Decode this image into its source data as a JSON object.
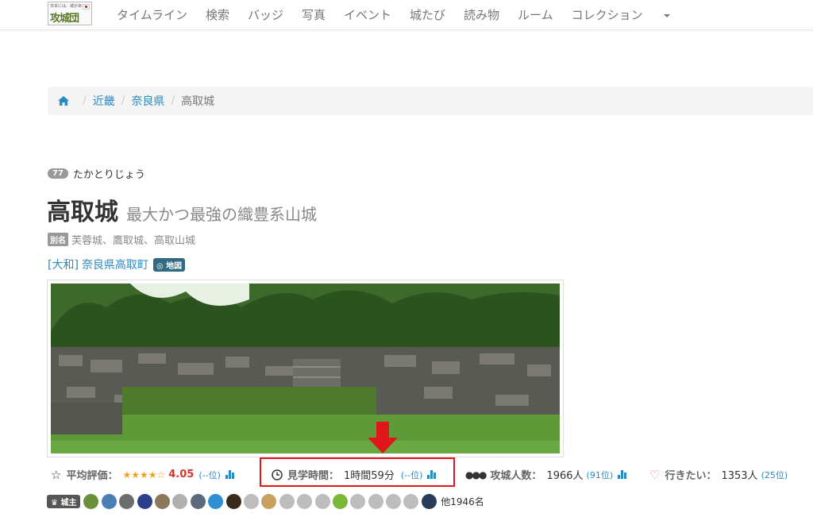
{
  "navbar": {
    "logo": {
      "tagline": "日本には、城がある",
      "mark": "攻城団"
    },
    "items": [
      "タイムライン",
      "検索",
      "バッジ",
      "写真",
      "イベント",
      "城たび",
      "読み物",
      "ルーム"
    ],
    "dropdown": "コレクション"
  },
  "breadcrumb": [
    "近畿",
    "奈良県",
    "高取城"
  ],
  "castle": {
    "number": "77",
    "reading": "たかとりじょう",
    "name": "高取城",
    "subtitle": "最大かつ最強の織豊系山城",
    "alias_tag": "別名",
    "aliases": "芙蓉城、鷹取城、高取山城",
    "province": "[大和]",
    "address": "奈良県高取町",
    "map_label": "地図"
  },
  "stats": {
    "rating": {
      "label": "平均評価：",
      "stars": "★★★★☆",
      "value": "4.05",
      "rank": "(--位)"
    },
    "visit_time": {
      "label": "見学時間：",
      "value": "1時間59分",
      "rank": "(--位)"
    },
    "visitors": {
      "label": "攻城人数：",
      "value": "1966人",
      "rank": "(91位)"
    },
    "want": {
      "label": "行きたい：",
      "value": "1353人",
      "rank": "(25位)"
    }
  },
  "lords": {
    "label": "城主",
    "others": "他1946名",
    "avatar_colors": [
      "#6b8f3a",
      "#4a7fb5",
      "#6d6d6d",
      "#2b3f8c",
      "#8a7a5a",
      "#b0b0b0",
      "#5a6a7a",
      "#2f8fd0",
      "#3a2a1a",
      "#bdbdbd",
      "#c8a060",
      "#bdbdbd",
      "#bdbdbd",
      "#bdbdbd",
      "#7ab83a",
      "#bdbdbd",
      "#bdbdbd",
      "#bdbdbd",
      "#bdbdbd",
      "#2a3a5a"
    ]
  },
  "highlight_color": "#e0161b",
  "link_color": "#2a8ac2"
}
